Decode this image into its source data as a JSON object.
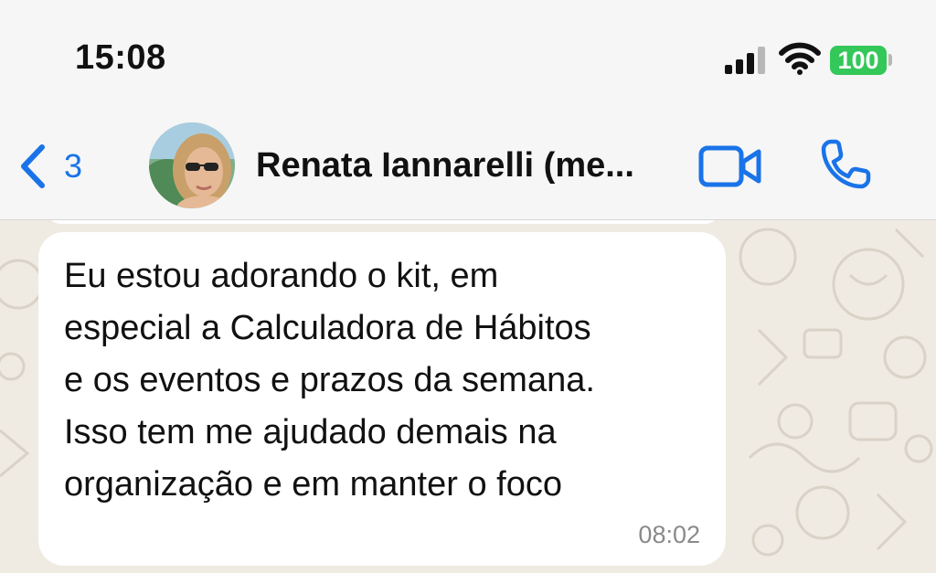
{
  "status_bar": {
    "time": "15:08",
    "battery": "100",
    "battery_color": "#34c759"
  },
  "header": {
    "back_count": "3",
    "contact_name": "Renata Iannarelli (me...",
    "accent_color": "#1a73e8",
    "icons": {
      "back": "chevron-left-icon",
      "video": "video-camera-icon",
      "call": "phone-icon"
    }
  },
  "chat": {
    "messages": [
      {
        "lines": [
          "Eu estou adorando o kit, em",
          "especial a Calculadora de Hábitos",
          "e os eventos e prazos da semana.",
          "Isso tem me ajudado demais na",
          "organização e em manter o foco"
        ],
        "time": "08:02"
      }
    ]
  }
}
